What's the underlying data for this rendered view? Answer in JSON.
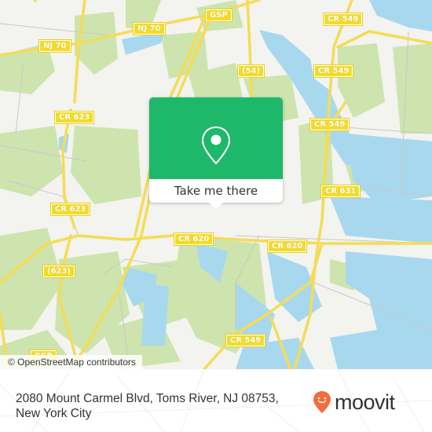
{
  "map": {
    "attribution": "© OpenStreetMap contributors",
    "colors": {
      "land": "#f3f3ef",
      "park": "#cde4ae",
      "water": "#a8d8ee",
      "road": "#f5dc55",
      "road_casing": "#e6c93a",
      "minor_road": "#c8c8c8",
      "shield": "#f2dc2b"
    },
    "road_labels": [
      {
        "id": "nj70-a",
        "text": "NJ 70"
      },
      {
        "id": "nj70-b",
        "text": "NJ 70"
      },
      {
        "id": "gsp-top",
        "text": "GSP"
      },
      {
        "id": "cr549-a",
        "text": "CR 549"
      },
      {
        "id": "r54",
        "text": "(54)"
      },
      {
        "id": "cr549-b",
        "text": "CR 549"
      },
      {
        "id": "cr623-a",
        "text": "CR 623"
      },
      {
        "id": "cr549-c",
        "text": "CR 549"
      },
      {
        "id": "cr631",
        "text": "CR 631"
      },
      {
        "id": "cr623-b",
        "text": "CR 623"
      },
      {
        "id": "cr620-a",
        "text": "CR 620"
      },
      {
        "id": "cr620-b",
        "text": "CR 620"
      },
      {
        "id": "r623",
        "text": "(623)"
      },
      {
        "id": "cr549-d",
        "text": "CR 549"
      },
      {
        "id": "gsp-bottom",
        "text": "GSP"
      }
    ]
  },
  "popup": {
    "icon": "map-pin-icon",
    "button_label": "Take me there",
    "accent": "#1eb86b"
  },
  "footer": {
    "address": "2080 Mount Carmel Blvd, Toms River, NJ 08753, New York City",
    "logo_text": "moovit",
    "logo_icon": "moovit-pin-smile-icon",
    "logo_color": "#f26e3f"
  }
}
